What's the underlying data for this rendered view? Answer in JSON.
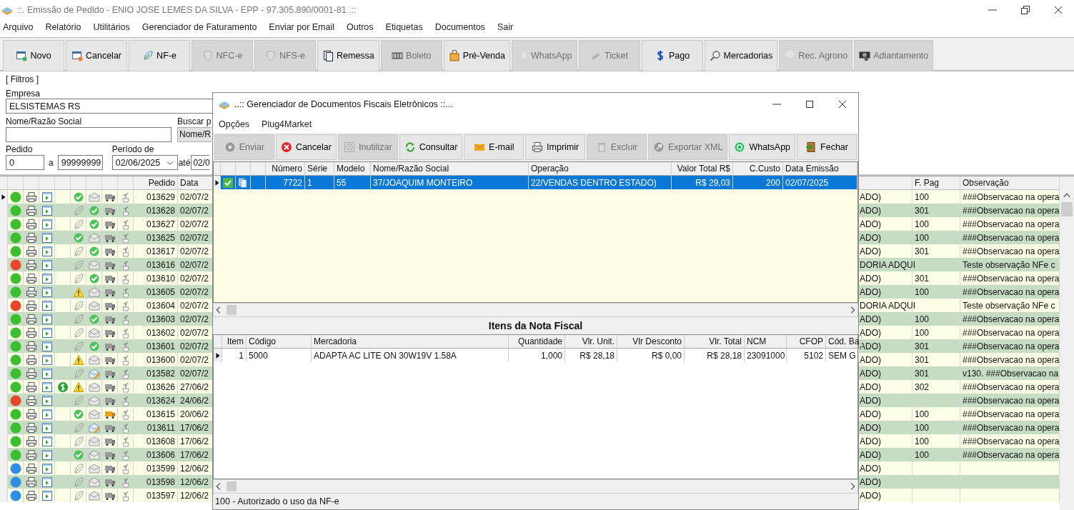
{
  "window": {
    "title": "::. Emissão de Pedido - ENIO JOSE LEMES DA SILVA - EPP - 97.305.890/0001-81 .::"
  },
  "menu": [
    "Arquivo",
    "Relatório",
    "Utilitários",
    "Gerenciador de Faturamento",
    "Enviar por Email",
    "Outros",
    "Etiquetas",
    "Documentos",
    "Sair"
  ],
  "toolbar": [
    {
      "label": "Novo",
      "disabled": false
    },
    {
      "label": "Cancelar",
      "disabled": false
    },
    {
      "label": "NF-e",
      "disabled": false
    },
    {
      "label": "NFC-e",
      "disabled": true
    },
    {
      "label": "NFS-e",
      "disabled": true
    },
    {
      "label": "Remessa",
      "disabled": false
    },
    {
      "label": "Boleto",
      "disabled": true
    },
    {
      "label": "Pré-Venda",
      "disabled": false
    },
    {
      "label": "WhatsApp",
      "disabled": true
    },
    {
      "label": "Ticket",
      "disabled": true
    },
    {
      "label": "Pago",
      "disabled": false
    },
    {
      "label": "Mercadorias",
      "disabled": false
    },
    {
      "label": "Rec. Agrono",
      "disabled": true
    },
    {
      "label": "Adiantamento",
      "disabled": true
    }
  ],
  "filters": {
    "legend": "[ Filtros ]",
    "empresa_label": "Empresa",
    "empresa_value": "ELSISTEMAS RS",
    "nome_label": "Nome/Razão Social",
    "buscar_label": "Buscar p",
    "buscar_value": "Nome/R",
    "pedido_label": "Pedido",
    "pedido_from": "0",
    "pedido_sep": "a",
    "pedido_to": "99999999",
    "periodo_label": "Período de",
    "periodo_from": "02/06/2025",
    "periodo_sep": "até",
    "periodo_to": "02/0"
  },
  "grid": {
    "columns": [
      "Pedido",
      "Data",
      "F. Pag",
      "Observação"
    ],
    "rows": [
      {
        "selected": true,
        "color": "#3cbf2e",
        "payment": false,
        "nfe_ok": true,
        "nfe_warning": false,
        "email_sent": false,
        "email_edited": false,
        "truck_highlighted": false,
        "pedido": "013629",
        "data": "02/07/2",
        "column_3": "ADO)",
        "f_pag": "100",
        "observacao": "###Observacao na opera"
      },
      {
        "selected": false,
        "color": "#3cbf2e",
        "payment": false,
        "nfe_ok": false,
        "nfe_warning": false,
        "email_sent": true,
        "email_edited": false,
        "truck_highlighted": false,
        "pedido": "013628",
        "data": "02/07/2",
        "column_3": "ADO)",
        "f_pag": "301",
        "observacao": "###Observacao na opera"
      },
      {
        "selected": false,
        "color": "#3cbf2e",
        "payment": false,
        "nfe_ok": false,
        "nfe_warning": false,
        "email_sent": true,
        "email_edited": false,
        "truck_highlighted": false,
        "pedido": "013627",
        "data": "02/07/2",
        "column_3": "ADO)",
        "f_pag": "100",
        "observacao": "###Observacao na opera"
      },
      {
        "selected": false,
        "color": "#3cbf2e",
        "payment": false,
        "nfe_ok": true,
        "nfe_warning": false,
        "email_sent": false,
        "email_edited": false,
        "truck_highlighted": false,
        "pedido": "013625",
        "data": "02/07/2",
        "column_3": "ADO)",
        "f_pag": "100",
        "observacao": "###Observacao na opera"
      },
      {
        "selected": false,
        "color": "#3cbf2e",
        "payment": false,
        "nfe_ok": false,
        "nfe_warning": false,
        "email_sent": true,
        "email_edited": false,
        "truck_highlighted": false,
        "pedido": "013617",
        "data": "02/07/2",
        "column_3": "ADO)",
        "f_pag": "301",
        "observacao": "###Observacao na opera"
      },
      {
        "selected": false,
        "color": "#e8472a",
        "payment": false,
        "nfe_ok": false,
        "nfe_warning": false,
        "email_sent": false,
        "email_edited": false,
        "truck_highlighted": false,
        "pedido": "013616",
        "data": "02/07/2",
        "column_3": "DORIA ADQUI",
        "observacao": "Teste observação NFe c"
      },
      {
        "selected": false,
        "color": "#3cbf2e",
        "payment": false,
        "nfe_ok": false,
        "nfe_warning": false,
        "email_sent": true,
        "email_edited": false,
        "truck_highlighted": false,
        "pedido": "013610",
        "data": "02/07/2",
        "column_3": "ADO)",
        "f_pag": "301",
        "observacao": "###Observacao na opera"
      },
      {
        "selected": false,
        "color": "#3cbf2e",
        "payment": false,
        "nfe_ok": false,
        "nfe_warning": true,
        "email_sent": false,
        "email_edited": false,
        "truck_highlighted": false,
        "pedido": "013605",
        "data": "02/07/2",
        "column_3": "ADO)",
        "f_pag": "100",
        "observacao": "###Observacao na opera"
      },
      {
        "selected": false,
        "color": "#e8472a",
        "payment": false,
        "nfe_ok": false,
        "nfe_warning": false,
        "email_sent": false,
        "email_edited": false,
        "truck_highlighted": false,
        "pedido": "013604",
        "data": "02/07/2",
        "column_3": "DORIA ADQUI",
        "observacao": "Teste observação NFe c"
      },
      {
        "selected": false,
        "color": "#3cbf2e",
        "payment": false,
        "nfe_ok": false,
        "nfe_warning": false,
        "email_sent": true,
        "email_edited": false,
        "truck_highlighted": false,
        "pedido": "013603",
        "data": "02/07/2",
        "column_3": "ADO)",
        "f_pag": "100",
        "observacao": "###Observacao na opera"
      },
      {
        "selected": false,
        "color": "#3cbf2e",
        "payment": false,
        "nfe_ok": false,
        "nfe_warning": false,
        "email_sent": false,
        "email_edited": false,
        "truck_highlighted": false,
        "pedido": "013602",
        "data": "02/07/2",
        "column_3": "ADO)",
        "f_pag": "100",
        "observacao": "###Observacao na opera"
      },
      {
        "selected": false,
        "color": "#3cbf2e",
        "payment": false,
        "nfe_ok": false,
        "nfe_warning": false,
        "email_sent": true,
        "email_edited": false,
        "truck_highlighted": false,
        "pedido": "013601",
        "data": "02/07/2",
        "column_3": "ADO)",
        "f_pag": "301",
        "observacao": "###Observacao na opera"
      },
      {
        "selected": false,
        "color": "#3cbf2e",
        "payment": false,
        "nfe_ok": false,
        "nfe_warning": true,
        "email_sent": false,
        "email_edited": false,
        "truck_highlighted": false,
        "pedido": "013600",
        "data": "02/07/2",
        "column_3": "ADO)",
        "f_pag": "301",
        "observacao": "###Observacao na opera"
      },
      {
        "selected": false,
        "color": "#3cbf2e",
        "payment": false,
        "nfe_ok": false,
        "nfe_warning": false,
        "email_sent": false,
        "email_edited": true,
        "truck_highlighted": false,
        "pedido": "013582",
        "data": "02/07/2",
        "column_3": "ADO)",
        "f_pag": "301",
        "observacao": "v130. ###Observacao na"
      },
      {
        "selected": false,
        "color": "#3cbf2e",
        "payment": true,
        "nfe_ok": false,
        "nfe_warning": true,
        "email_sent": false,
        "email_edited": false,
        "truck_highlighted": false,
        "pedido": "013626",
        "data": "27/06/2",
        "column_3": "ADO)",
        "f_pag": "302",
        "observacao": "###Observacao na opera"
      },
      {
        "selected": false,
        "color": "#e8472a",
        "payment": false,
        "nfe_ok": false,
        "nfe_warning": false,
        "email_sent": false,
        "email_edited": false,
        "truck_highlighted": false,
        "pedido": "013624",
        "data": "24/06/2",
        "column_3": "ADO)",
        "observacao": "###Observacao na opera"
      },
      {
        "selected": false,
        "color": "#3cbf2e",
        "payment": false,
        "nfe_ok": true,
        "nfe_warning": false,
        "email_sent": false,
        "email_edited": false,
        "truck_highlighted": true,
        "pedido": "013615",
        "data": "20/06/2",
        "column_3": "ADO)",
        "f_pag": "100",
        "observacao": "###Observacao na opera"
      },
      {
        "selected": false,
        "color": "#3cbf2e",
        "payment": false,
        "nfe_ok": false,
        "nfe_warning": false,
        "email_sent": false,
        "email_edited": true,
        "truck_highlighted": false,
        "pedido": "013611",
        "data": "17/06/2",
        "column_3": "ADO)",
        "f_pag": "100",
        "observacao": "###Observacao na opera"
      },
      {
        "selected": false,
        "color": "#3cbf2e",
        "payment": false,
        "nfe_ok": false,
        "nfe_warning": false,
        "email_sent": false,
        "email_edited": false,
        "truck_highlighted": false,
        "pedido": "013608",
        "data": "17/06/2",
        "column_3": "ADO)",
        "f_pag": "100",
        "observacao": "###Observacao na opera"
      },
      {
        "selected": false,
        "color": "#3cbf2e",
        "payment": false,
        "nfe_ok": true,
        "nfe_warning": false,
        "email_sent": false,
        "email_edited": false,
        "truck_highlighted": false,
        "pedido": "013606",
        "data": "17/06/2",
        "column_3": "ADO)",
        "f_pag": "100",
        "observacao": "###Observacao na opera"
      },
      {
        "selected": false,
        "color": "#2f8fe0",
        "payment": false,
        "nfe_ok": false,
        "nfe_warning": false,
        "email_sent": false,
        "email_edited": false,
        "truck_highlighted": false,
        "pedido": "013599",
        "data": "12/06/2",
        "column_3": "ADO)"
      },
      {
        "selected": false,
        "color": "#2f8fe0",
        "payment": false,
        "nfe_ok": false,
        "nfe_warning": false,
        "email_sent": false,
        "email_edited": false,
        "truck_highlighted": false,
        "pedido": "013598",
        "data": "12/06/2",
        "column_3": "ADO)"
      },
      {
        "selected": false,
        "color": "#2f8fe0",
        "payment": false,
        "nfe_ok": false,
        "nfe_warning": false,
        "email_sent": false,
        "email_edited": false,
        "truck_highlighted": false,
        "pedido": "013597",
        "data": "12/06/2",
        "column_3": "ADO)"
      }
    ]
  },
  "dialog": {
    "title": "..:: Gerenciador de Documentos Fiscais Eletrônicos ::...",
    "menu": [
      "Opções",
      "Plug4Market"
    ],
    "toolbar": [
      {
        "label": "Enviar",
        "disabled": true
      },
      {
        "label": "Cancelar",
        "disabled": false
      },
      {
        "label": "Inutilizar",
        "disabled": true
      },
      {
        "label": "Consultar",
        "disabled": false
      },
      {
        "label": "E-mail",
        "disabled": false
      },
      {
        "label": "Imprimir",
        "disabled": false
      },
      {
        "label": "Excluir",
        "disabled": true
      },
      {
        "label": "Exportar XML",
        "disabled": true
      },
      {
        "label": "WhatsApp",
        "disabled": false
      },
      {
        "label": "Fechar",
        "disabled": false
      }
    ],
    "documents": {
      "columns": [
        "Número",
        "Série",
        "Modelo",
        "Nome/Razão Social",
        "Operação",
        "Valor Total R$",
        "C.Custo",
        "Data Emissão"
      ],
      "rows": [
        {
          "selected": true,
          "authorized": true,
          "cells": [
            "7722",
            "1",
            "55",
            "37/JOAQUIM MONTEIRO",
            "22/VENDAS DENTRO ESTADO)",
            "R$ 29,03",
            "200",
            "02/07/2025"
          ]
        }
      ]
    },
    "items_title": "Itens da Nota Fiscal",
    "items": {
      "columns": [
        "Item",
        "Código",
        "Mercadoria",
        "Quantidade",
        "Vlr. Unit.",
        "Vlr Desconto",
        "Vlr. Total",
        "NCM",
        "CFOP",
        "Cód. Ba"
      ],
      "rows": [
        {
          "selected": true,
          "cells": [
            "1",
            "5000",
            "ADAPTA AC LITE ON 30W19V 1.58A",
            "1,000",
            "R$ 28,18",
            "R$ 0,00",
            "R$ 28,18",
            "23091000",
            "5102",
            "SEM G"
          ]
        }
      ]
    },
    "status_bar": "100 - Autorizado o uso da NF-e"
  }
}
